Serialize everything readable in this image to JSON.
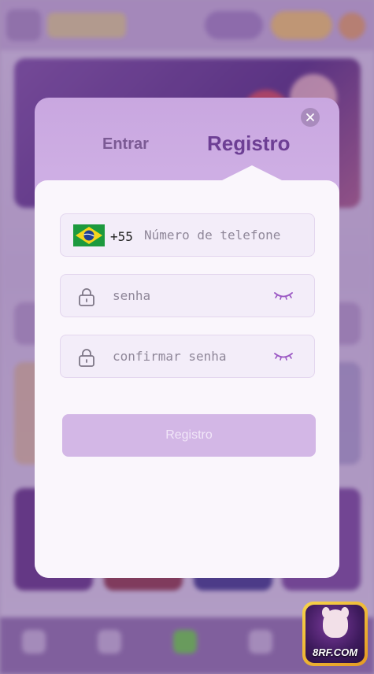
{
  "tabs": {
    "login_label": "Entrar",
    "register_label": "Registro",
    "active": "register"
  },
  "close_icon": "close-icon",
  "form": {
    "phone": {
      "country_flag": "brazil-flag-icon",
      "dial_code": "+55",
      "placeholder": "Número de telefone",
      "value": ""
    },
    "password": {
      "placeholder": "senha",
      "value": "",
      "left_icon": "lock-icon",
      "right_icon": "eye-closed-icon"
    },
    "confirm_password": {
      "placeholder": "confirmar senha",
      "value": "",
      "left_icon": "lock-icon",
      "right_icon": "eye-closed-icon"
    },
    "submit_label": "Registro"
  },
  "promo_badge": {
    "text": "8RF.COM"
  },
  "colors": {
    "accent": "#6d3f94",
    "submit_disabled": "#d3b7e6",
    "field_bg": "#f3edf9"
  }
}
